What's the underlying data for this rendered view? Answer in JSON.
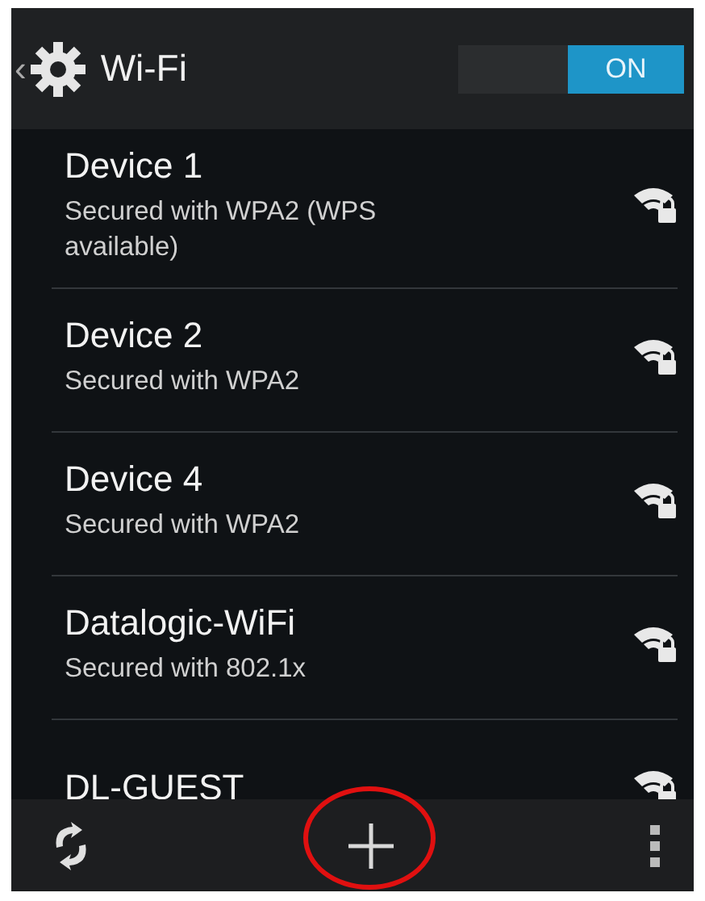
{
  "header": {
    "back": "‹",
    "title": "Wi-Fi",
    "toggle": {
      "label": "ON",
      "on": true
    }
  },
  "networks": [
    {
      "name": "Device 1",
      "status": "Secured with WPA2 (WPS available)"
    },
    {
      "name": "Device 2",
      "status": "Secured with WPA2"
    },
    {
      "name": "Device 4",
      "status": "Secured with WPA2"
    },
    {
      "name": "Datalogic-WiFi",
      "status": "Secured with 802.1x"
    },
    {
      "name": "DL-GUEST"
    }
  ],
  "bottom_bar": {
    "add_highlighted": true
  }
}
